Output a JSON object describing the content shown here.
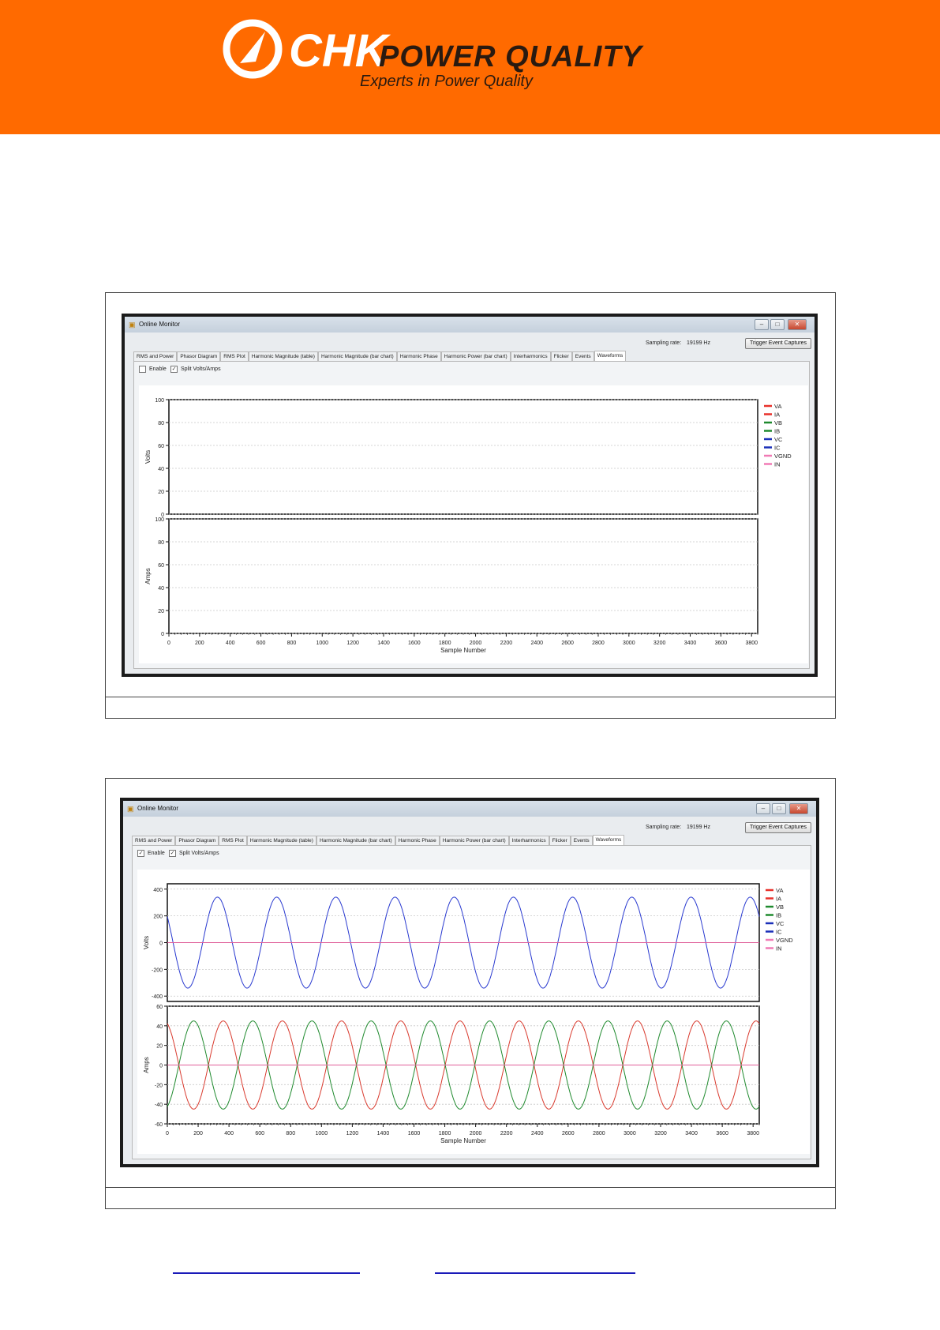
{
  "brand": {
    "name_part1": "CHK",
    "name_part2": "POWER QUALITY",
    "tagline": "Experts in Power Quality",
    "banner_color": "#ff6a00"
  },
  "figures": [
    {
      "window": {
        "title": "Online Monitor",
        "sampling_rate_label": "Sampling rate:",
        "sampling_rate_value": "19199 Hz",
        "trigger_button": "Trigger Event Captures",
        "tabs": [
          "RMS and Power",
          "Phasor Diagram",
          "RMS Plot",
          "Harmonic Magnitude (table)",
          "Harmonic Magnitude (bar chart)",
          "Harmonic Phase",
          "Harmonic Power (bar chart)",
          "Interharmonics",
          "Flicker",
          "Events",
          "Waveforms"
        ],
        "active_tab": "Waveforms",
        "enable_label": "Enable",
        "enable_checked": false,
        "split_label": "Split Volts/Amps",
        "split_checked": true
      },
      "chart_data": {
        "type": "line",
        "title": "",
        "xlabel": "Sample Number",
        "xlim": [
          0,
          3840
        ],
        "xticks": [
          0,
          200,
          400,
          600,
          800,
          1000,
          1200,
          1400,
          1600,
          1800,
          2000,
          2200,
          2400,
          2600,
          2800,
          3000,
          3200,
          3400,
          3600,
          3800
        ],
        "xtick_labels": [
          "0",
          "200",
          "400",
          "600",
          "800",
          "1000",
          "1200",
          "1400",
          "1600",
          "1800",
          "2000",
          "2200",
          "2400",
          "2600",
          "2800",
          "3000",
          "3200",
          "3400",
          "3600",
          "3800"
        ],
        "panels": [
          {
            "ylabel": "Volts",
            "ylim": [
              0,
              100
            ],
            "yticks": [
              0,
              20,
              40,
              60,
              80,
              100
            ],
            "ytick_labels": [
              "0",
              "20",
              "40",
              "60",
              "80",
              "100"
            ]
          },
          {
            "ylabel": "Amps",
            "ylim": [
              0,
              100
            ],
            "yticks": [
              0,
              20,
              40,
              60,
              80,
              100
            ],
            "ytick_labels": [
              "0",
              "20",
              "40",
              "60",
              "80",
              "100"
            ]
          }
        ],
        "legend_position": "right",
        "legend": [
          {
            "name": "VA",
            "color": "#e8312b"
          },
          {
            "name": "IA",
            "color": "#e8312b"
          },
          {
            "name": "VB",
            "color": "#1f8a2e"
          },
          {
            "name": "IB",
            "color": "#1f8a2e"
          },
          {
            "name": "VC",
            "color": "#1a2fb8"
          },
          {
            "name": "IC",
            "color": "#1a2fb8"
          },
          {
            "name": "VGND",
            "color": "#f07ab5"
          },
          {
            "name": "IN",
            "color": "#f07ab5"
          }
        ],
        "series": []
      }
    },
    {
      "window": {
        "title": "Online Monitor",
        "sampling_rate_label": "Sampling rate:",
        "sampling_rate_value": "19199 Hz",
        "trigger_button": "Trigger Event Captures",
        "tabs": [
          "RMS and Power",
          "Phasor Diagram",
          "RMS Plot",
          "Harmonic Magnitude (table)",
          "Harmonic Magnitude (bar chart)",
          "Harmonic Phase",
          "Harmonic Power (bar chart)",
          "Interharmonics",
          "Flicker",
          "Events",
          "Waveforms"
        ],
        "active_tab": "Waveforms",
        "enable_label": "Enable",
        "enable_checked": true,
        "split_label": "Split Volts/Amps",
        "split_checked": true
      },
      "chart_data": {
        "type": "line",
        "title": "",
        "xlabel": "Sample Number",
        "xlim": [
          0,
          3840
        ],
        "xticks": [
          0,
          200,
          400,
          600,
          800,
          1000,
          1200,
          1400,
          1600,
          1800,
          2000,
          2200,
          2400,
          2600,
          2800,
          3000,
          3200,
          3400,
          3600,
          3800
        ],
        "xtick_labels": [
          "0",
          "200",
          "400",
          "600",
          "800",
          "1000",
          "1200",
          "1400",
          "1600",
          "1800",
          "2000",
          "2200",
          "2400",
          "2600",
          "2800",
          "3000",
          "3200",
          "3400",
          "3600",
          "3800"
        ],
        "panels": [
          {
            "ylabel": "Volts",
            "ylim": [
              -440,
              440
            ],
            "yticks": [
              -400,
              -200,
              0,
              200,
              400
            ],
            "ytick_labels": [
              "-400",
              "-200",
              "0",
              "200",
              "400"
            ]
          },
          {
            "ylabel": "Amps",
            "ylim": [
              -60,
              60
            ],
            "yticks": [
              -60,
              -40,
              -20,
              0,
              20,
              40,
              60
            ],
            "ytick_labels": [
              "-60",
              "-40",
              "-20",
              "0",
              "20",
              "40",
              "60"
            ]
          }
        ],
        "legend_position": "right",
        "legend": [
          {
            "name": "VA",
            "color": "#e8312b"
          },
          {
            "name": "IA",
            "color": "#e8312b"
          },
          {
            "name": "VB",
            "color": "#1f8a2e"
          },
          {
            "name": "IB",
            "color": "#1f8a2e"
          },
          {
            "name": "VC",
            "color": "#1a2fb8"
          },
          {
            "name": "IC",
            "color": "#1a2fb8"
          },
          {
            "name": "VGND",
            "color": "#f07ab5"
          },
          {
            "name": "IN",
            "color": "#f07ab5"
          }
        ],
        "series": [
          {
            "name": "VC",
            "panel": 0,
            "color": "#2a3ad0",
            "kind": "sine",
            "amplitude": 340,
            "period": 384,
            "phase_deg": 145,
            "offset": 0
          },
          {
            "name": "VGND",
            "panel": 0,
            "color": "#e0609a",
            "kind": "sine",
            "amplitude": 0,
            "period": 384,
            "phase_deg": 0,
            "offset": 0
          },
          {
            "name": "IA",
            "panel": 1,
            "color": "#d93a2e",
            "kind": "sine",
            "amplitude": 45,
            "period": 384,
            "phase_deg": 110,
            "offset": 0
          },
          {
            "name": "IB",
            "panel": 1,
            "color": "#1f8a2e",
            "kind": "sine",
            "amplitude": 45,
            "period": 384,
            "phase_deg": 290,
            "offset": 0
          },
          {
            "name": "IN",
            "panel": 1,
            "color": "#e0609a",
            "kind": "sine",
            "amplitude": 0,
            "period": 384,
            "phase_deg": 0,
            "offset": 0
          }
        ]
      }
    }
  ]
}
